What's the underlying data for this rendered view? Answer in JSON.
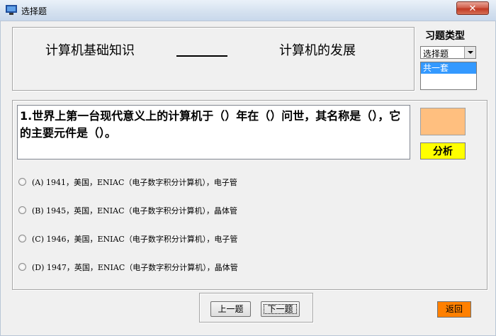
{
  "window": {
    "title": "选择题",
    "close_label": "✕"
  },
  "header": {
    "subject": "计算机基础知识",
    "chapter": "计算机的发展",
    "type_label": "习题类型",
    "type_select": {
      "selected": "选择题"
    },
    "set_list": {
      "items": [
        "共一套"
      ]
    }
  },
  "question": {
    "text": "1.世界上第一台现代意义上的计算机于（）年在（）问世，其名称是（），它的主要元件是（）。"
  },
  "side": {
    "analysis_label": "分析",
    "swatch_color": "#ffbf7f",
    "analysis_color": "#ffff00"
  },
  "options": [
    {
      "text": "(A) 1941，美国，ENIAC（电子数字积分计算机），电子管"
    },
    {
      "text": "(B) 1945，英国，ENIAC（电子数字积分计算机），晶体管"
    },
    {
      "text": "(C) 1946，美国，ENIAC（电子数字积分计算机），电子管"
    },
    {
      "text": "(D) 1947，英国，ENIAC（电子数字积分计算机），晶体管"
    }
  ],
  "nav": {
    "prev_label": "上一题",
    "next_label": "下一题",
    "back_label": "返回",
    "back_color": "#ff8000"
  }
}
